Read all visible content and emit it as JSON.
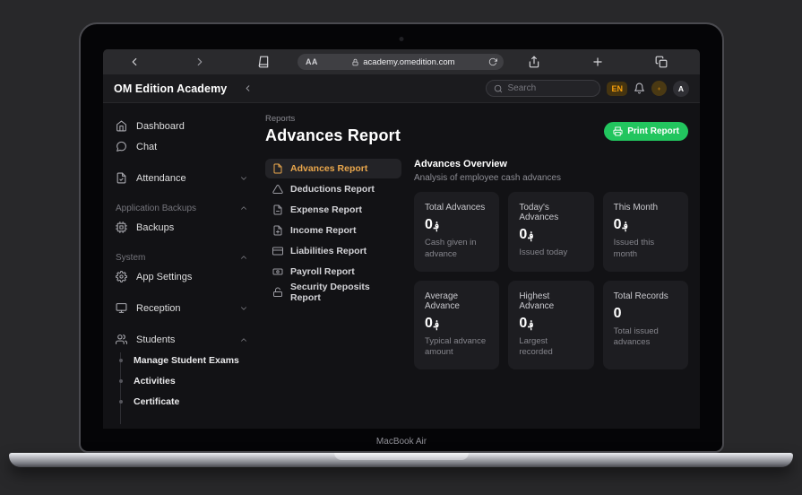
{
  "device": {
    "label": "MacBook Air"
  },
  "browser": {
    "text_size_button": "AA",
    "url": "academy.omedition.com"
  },
  "app_header": {
    "brand": "OM Edition Academy",
    "search_placeholder": "Search",
    "language_badge": "EN",
    "avatar_initial": "A"
  },
  "sidebar": {
    "entries": [
      {
        "type": "link",
        "label": "Dashboard",
        "icon": "home-icon"
      },
      {
        "type": "link",
        "label": "Chat",
        "icon": "chat-icon"
      },
      {
        "type": "link",
        "label": "Attendance",
        "icon": "file-check-icon",
        "chevron": "down",
        "spaced": true
      },
      {
        "type": "section",
        "label": "Application Backups",
        "chevron": "up",
        "spaced": true
      },
      {
        "type": "link",
        "label": "Backups",
        "icon": "chip-icon"
      },
      {
        "type": "section",
        "label": "System",
        "chevron": "up",
        "spaced": true
      },
      {
        "type": "link",
        "label": "App Settings",
        "icon": "gear-icon"
      },
      {
        "type": "link",
        "label": "Reception",
        "icon": "monitor-icon",
        "chevron": "down",
        "spaced": true
      },
      {
        "type": "link",
        "label": "Students",
        "icon": "users-icon",
        "chevron": "up",
        "spaced": true
      },
      {
        "type": "sublink",
        "label": "Manage Student Exams"
      },
      {
        "type": "sublink",
        "label": "Activities"
      },
      {
        "type": "sublink",
        "label": "Certificate"
      }
    ]
  },
  "report": {
    "breadcrumb": "Reports",
    "title": "Advances Report",
    "print_button": "Print Report",
    "nav": [
      {
        "label": "Advances Report",
        "icon": "file-icon",
        "active": true
      },
      {
        "label": "Deductions Report",
        "icon": "alert-triangle-icon",
        "active": false
      },
      {
        "label": "Expense Report",
        "icon": "file-minus-icon",
        "active": false
      },
      {
        "label": "Income Report",
        "icon": "file-plus-icon",
        "active": false
      },
      {
        "label": "Liabilities Report",
        "icon": "credit-card-icon",
        "active": false
      },
      {
        "label": "Payroll Report",
        "icon": "banknote-icon",
        "active": false
      },
      {
        "label": "Security Deposits Report",
        "icon": "lock-open-icon",
        "active": false
      }
    ]
  },
  "overview": {
    "title": "Advances Overview",
    "subtitle": "Analysis of employee cash advances",
    "cards": [
      {
        "title": "Total Advances",
        "value": "0",
        "currency": "؋",
        "subtitle": "Cash given in advance"
      },
      {
        "title": "Today's Advances",
        "value": "0",
        "currency": "؋",
        "subtitle": "Issued today"
      },
      {
        "title": "This Month",
        "value": "0",
        "currency": "؋",
        "subtitle": "Issued this month"
      },
      {
        "title": "Average Advance",
        "value": "0",
        "currency": "؋",
        "subtitle": "Typical advance amount"
      },
      {
        "title": "Highest Advance",
        "value": "0",
        "currency": "؋",
        "subtitle": "Largest recorded"
      },
      {
        "title": "Total Records",
        "value": "0",
        "currency": "",
        "subtitle": "Total issued advances"
      }
    ]
  },
  "colors": {
    "accent_amber": "#f59e0b",
    "accent_green": "#22c55e",
    "active_nav_text": "#eaa74c"
  }
}
